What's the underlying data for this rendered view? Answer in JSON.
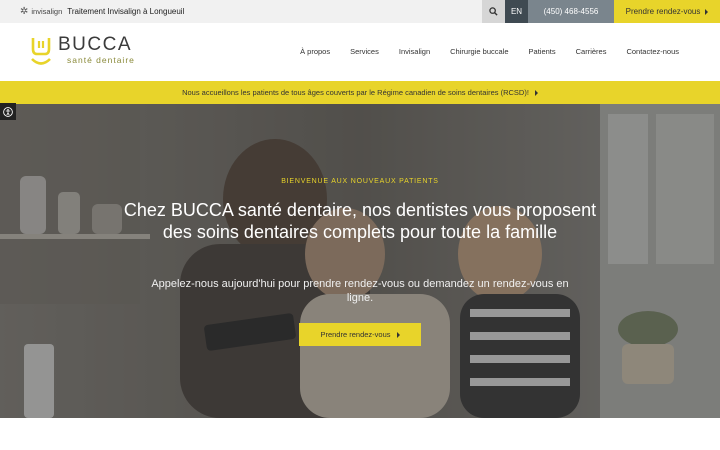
{
  "colors": {
    "accent": "#e8d42a",
    "dark": "#3f4a52",
    "phone_bg": "#7a858d",
    "topbar_bg": "#f1f1f1"
  },
  "topbar": {
    "invisalign_logo": "invisalign",
    "invisalign_link": "Traitement Invisalign à Longueuil",
    "search_icon": "search-icon",
    "language": "EN",
    "phone": "(450) 468-4556",
    "cta": "Prendre rendez-vous"
  },
  "header": {
    "logo_name": "BUCCA",
    "logo_sub": "santé dentaire",
    "nav": [
      "À propos",
      "Services",
      "Invisalign",
      "Chirurgie buccale",
      "Patients",
      "Carrières",
      "Contactez-nous"
    ]
  },
  "announcement": "Nous accueillons les patients de tous âges couverts par le Régime canadien de soins dentaires (RCSD)!",
  "hero": {
    "eyebrow": "BIENVENUE AUX NOUVEAUX PATIENTS",
    "headline": "Chez BUCCA santé dentaire, nos dentistes vous proposent des soins dentaires complets pour toute la famille",
    "subtext": "Appelez-nous aujourd'hui pour prendre rendez-vous ou demandez un rendez-vous en ligne.",
    "cta": "Prendre rendez-vous"
  }
}
